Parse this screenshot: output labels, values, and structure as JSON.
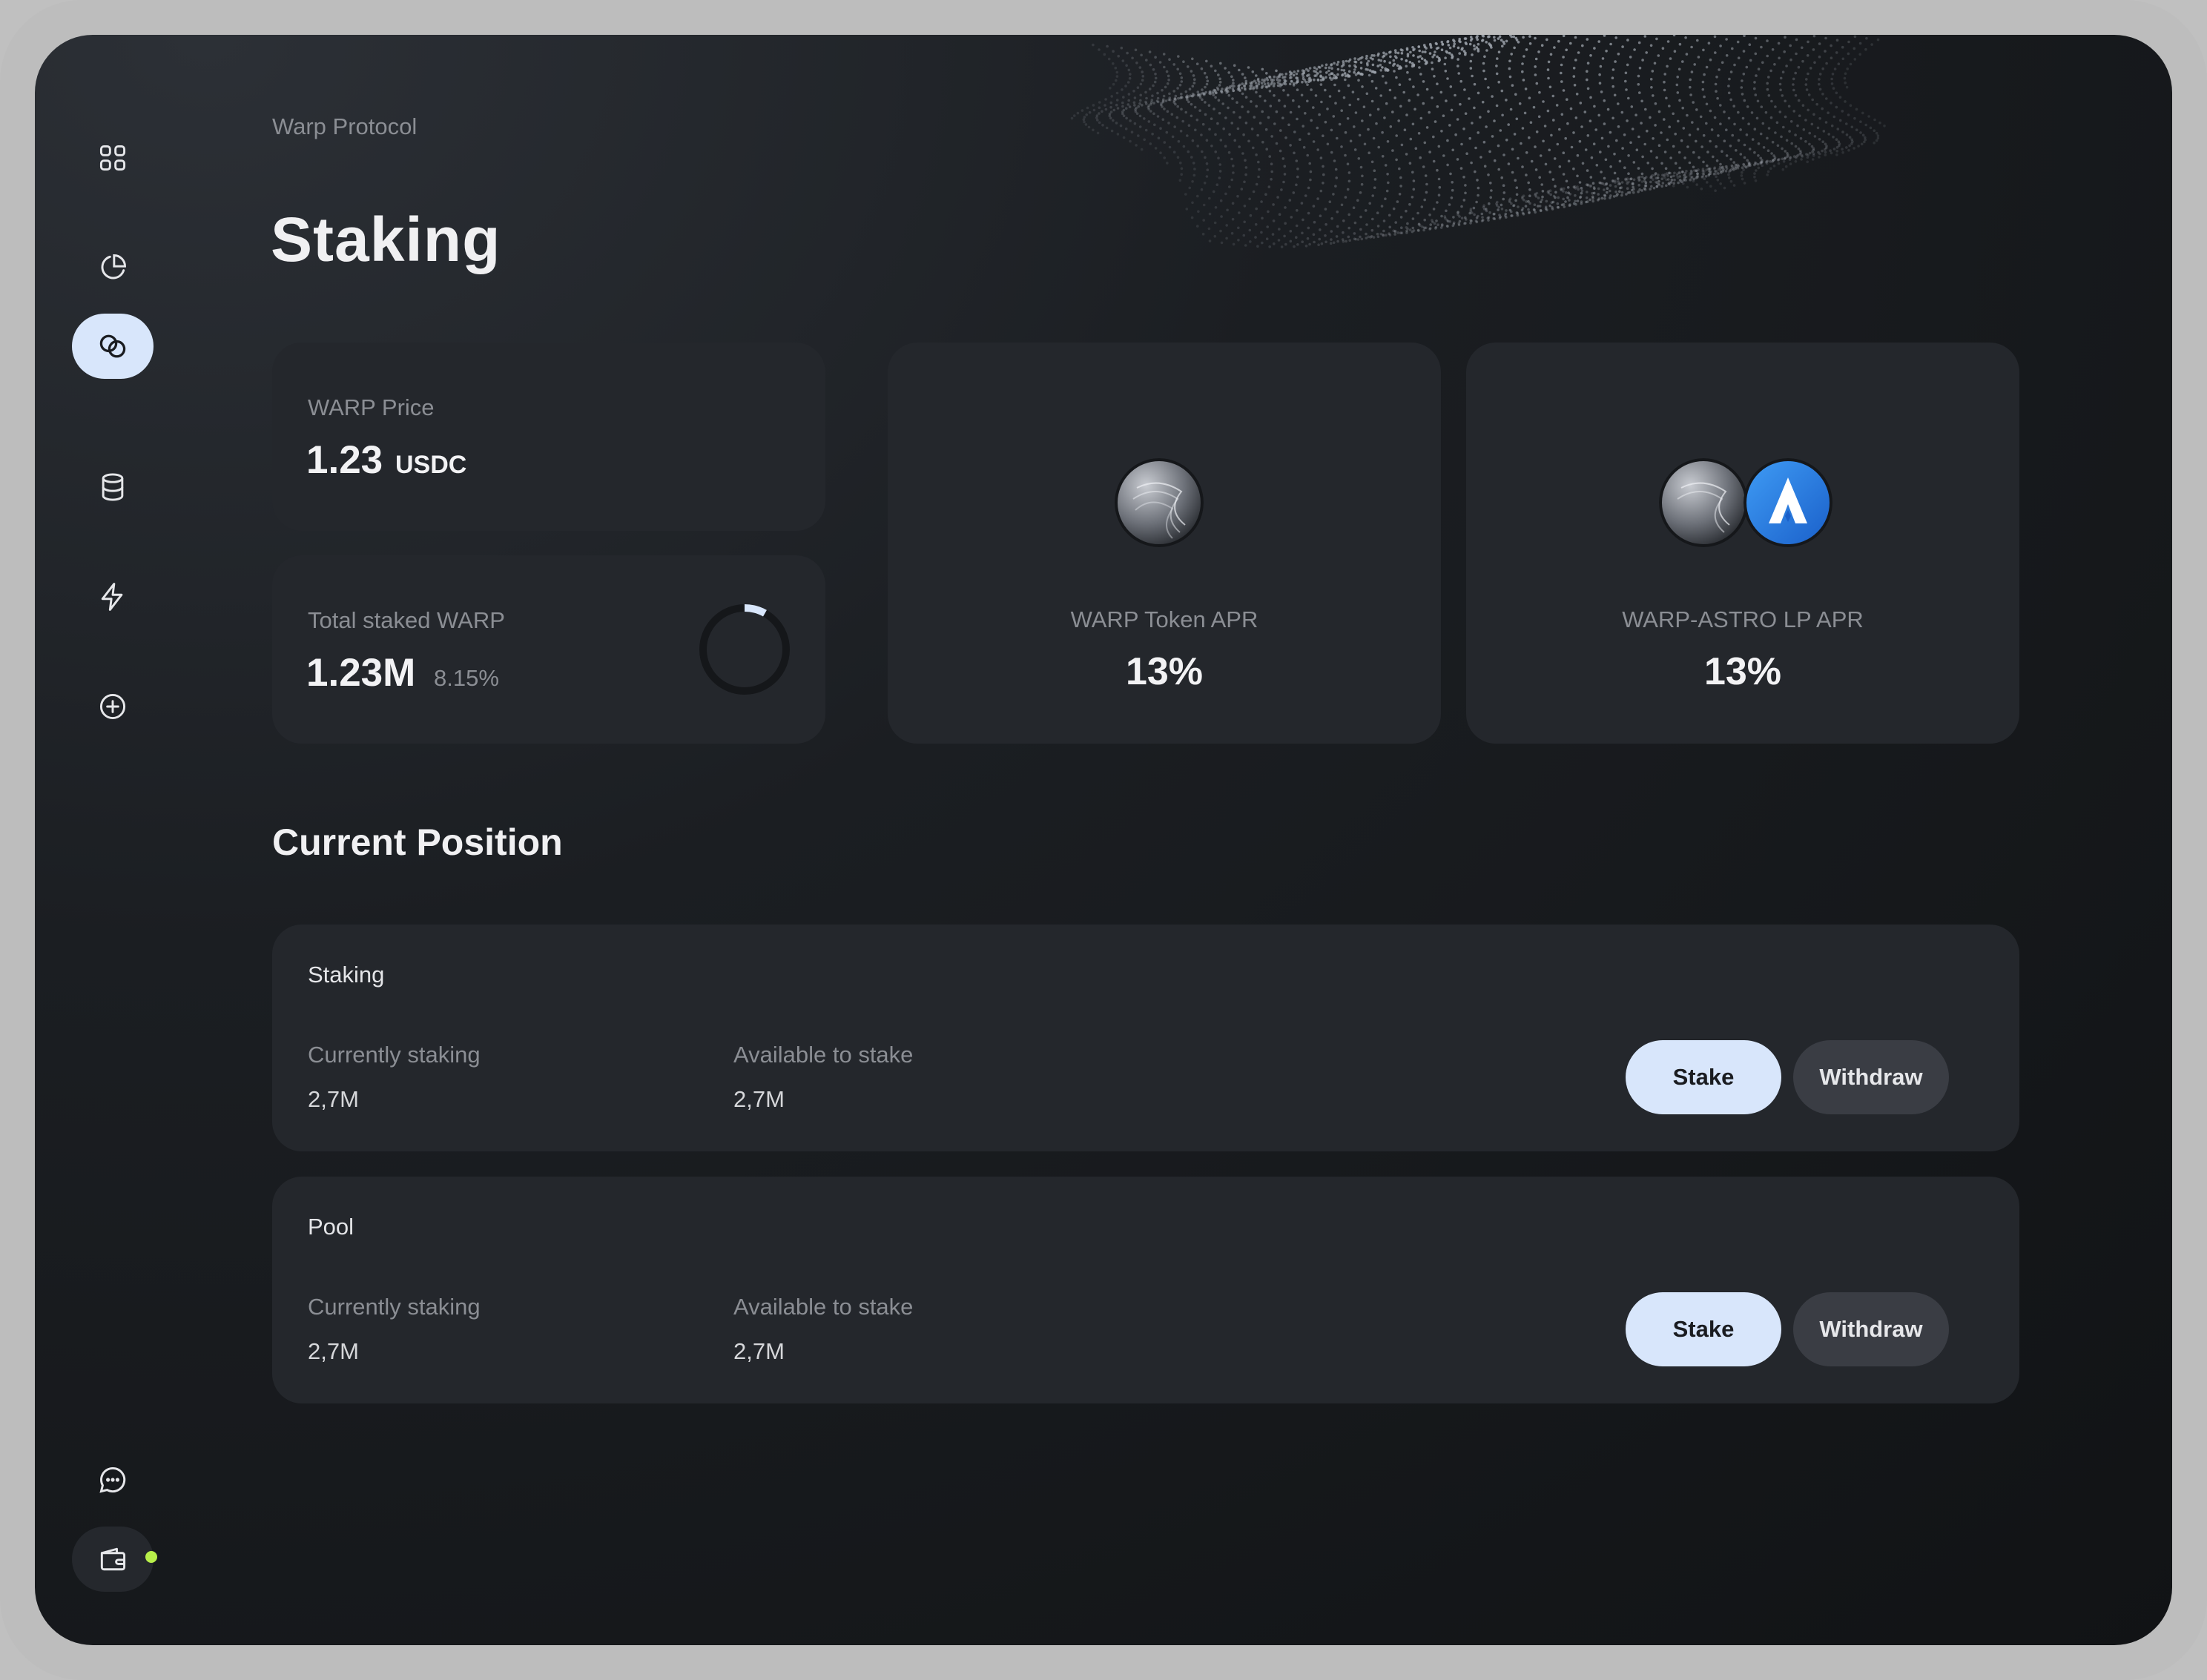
{
  "breadcrumb": "Warp Protocol",
  "page_title": "Staking",
  "nav": {
    "items": [
      {
        "icon": "grid-icon"
      },
      {
        "icon": "pie-chart-icon"
      },
      {
        "icon": "coins-icon",
        "active": true
      },
      {
        "icon": "database-icon"
      },
      {
        "icon": "lightning-icon"
      },
      {
        "icon": "plus-circle-icon"
      }
    ],
    "bottom": [
      {
        "icon": "chat-icon"
      },
      {
        "icon": "wallet-icon"
      }
    ],
    "wallet_status_color": "#b8ef4a"
  },
  "stats": {
    "price": {
      "label": "WARP Price",
      "value": "1.23",
      "unit": "USDC"
    },
    "total_staked": {
      "label": "Total staked WARP",
      "value": "1.23M",
      "percent": "8.15%",
      "ring_fraction": 0.0815
    },
    "token_apr": {
      "label": "WARP Token APR",
      "value": "13%"
    },
    "lp_apr": {
      "label": "WARP-ASTRO LP APR",
      "value": "13%"
    }
  },
  "section_title": "Current Position",
  "positions": [
    {
      "title": "Staking",
      "currently_label": "Currently staking",
      "currently_value": "2,7M",
      "available_label": "Available to stake",
      "available_value": "2,7M",
      "stake_label": "Stake",
      "withdraw_label": "Withdraw"
    },
    {
      "title": "Pool",
      "currently_label": "Currently staking",
      "currently_value": "2,7M",
      "available_label": "Available to stake",
      "available_value": "2,7M",
      "stake_label": "Stake",
      "withdraw_label": "Withdraw"
    }
  ],
  "colors": {
    "accent": "#d8e6fb",
    "background": "#1b1e22",
    "card": "#24272c",
    "astro_blue": "#2a7de1"
  }
}
